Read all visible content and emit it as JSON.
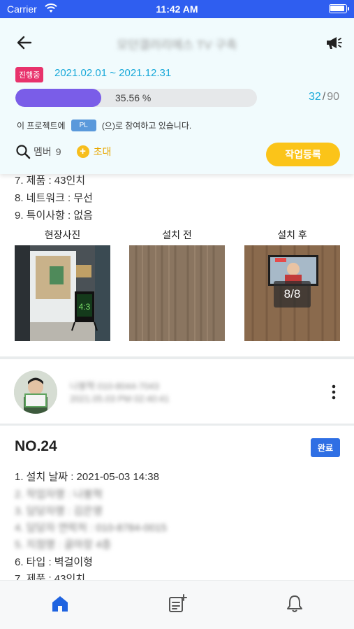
{
  "status_bar": {
    "carrier": "Carrier",
    "time": "11:42 AM"
  },
  "header": {
    "title": "모던갤러리에스 TV 구축",
    "status_badge": "진행중",
    "date_range": "2021.02.01 ~ 2021.12.31",
    "progress_fraction": 0.3556,
    "progress_text": "35.56 %",
    "count_done": "32",
    "count_sep": "/",
    "count_total": "90",
    "participation_prefix": "이 프로젝트에",
    "role": "PL",
    "participation_suffix": "(으)로 참여하고 있습니다.",
    "members_label": "멤버",
    "members_count": "9",
    "invite_label": "초대",
    "register_button": "작업등록"
  },
  "record_top": {
    "spec_lines": [
      "7. 제품 : 43인치",
      "8. 네트워크 : 무선",
      "9. 특이사항 : 없음"
    ],
    "photo_labels": [
      "현장사진",
      "설치 전",
      "설치 후"
    ],
    "photo_counter": "8/8",
    "sign_text": "4:3"
  },
  "record_author": {
    "name": "나봉혁 010-8044-7043",
    "time": "2021.05.03 PM 02:40:41"
  },
  "record_next": {
    "title": "NO.24",
    "badge": "완료",
    "lines": [
      "1. 설치 날짜 : 2021-05-03 14:38",
      "2. 작업자명 : 나봉혁",
      "3. 담당자명 : 김은영",
      "4. 담당자 연락처 : 010-8784-0015",
      "5. 지점명 : 골마장 4층",
      "6. 타입 : 벽걸이형",
      "7. 제품 : 43인치"
    ]
  },
  "colors": {
    "status_bar": "#2f5ef0",
    "header_bg": "#f1fbfd",
    "accent_blue": "#19a9d9",
    "progress": "#7a5de8",
    "badge_pink": "#e8336c",
    "yellow": "#fbc419",
    "tab_active": "#1f63e0"
  },
  "tabs": [
    {
      "icon": "home-icon",
      "active": true
    },
    {
      "icon": "add-note-icon",
      "active": false
    },
    {
      "icon": "bell-icon",
      "active": false
    }
  ]
}
